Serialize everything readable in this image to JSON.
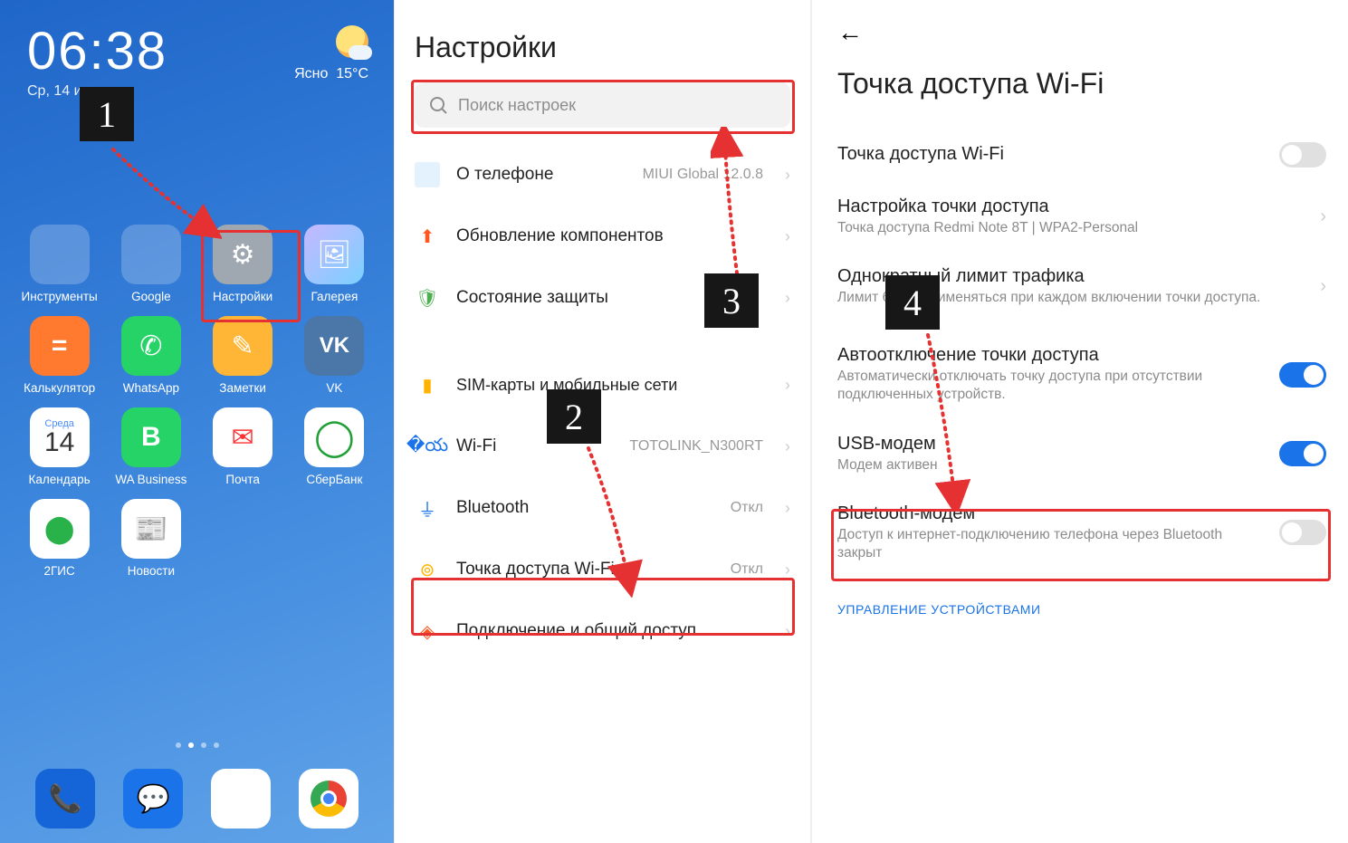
{
  "home": {
    "time": "06:38",
    "date": "Ср, 14 июля",
    "weather_text": "Ясно",
    "weather_temp": "15°C",
    "apps": {
      "tools": "Инструменты",
      "google": "Google",
      "settings": "Настройки",
      "gallery": "Галерея",
      "calc": "Калькулятор",
      "whatsapp": "WhatsApp",
      "notes": "Заметки",
      "vk": "VK",
      "cal_day": "Среда",
      "cal_num": "14",
      "calendar": "Календарь",
      "wab": "WA Business",
      "mail": "Почта",
      "sber": "СберБанк",
      "gis": "2ГИС",
      "news": "Новости"
    }
  },
  "settings": {
    "title": "Настройки",
    "search_placeholder": "Поиск настроек",
    "about": "О телефоне",
    "about_val": "MIUI Global 12.0.8",
    "update": "Обновление компонентов",
    "security": "Состояние защиты",
    "sim": "SIM-карты и мобильные сети",
    "wifi": "Wi-Fi",
    "wifi_val": "TOTOLINK_N300RT",
    "bt": "Bluetooth",
    "bt_val": "Откл",
    "hotspot": "Точка доступа Wi-Fi",
    "hotspot_val": "Откл",
    "share": "Подключение и общий доступ"
  },
  "hotspot": {
    "title": "Точка доступа Wi-Fi",
    "toggle_label": "Точка доступа Wi-Fi",
    "setup": "Настройка точки доступа",
    "setup_sub": "Точка доступа Redmi Note 8T | WPA2-Personal",
    "limit": "Однократный лимит трафика",
    "limit_sub": "Лимит будет применяться при каждом включении точки доступа.",
    "auto": "Автоотключение точки доступа",
    "auto_sub": "Автоматически отключать точку доступа при отсутствии подключенных устройств.",
    "usb": "USB-модем",
    "usb_sub": "Модем активен",
    "btm": "Bluetooth-модем",
    "btm_sub": "Доступ к интернет-подключению телефона через Bluetooth закрыт",
    "section": "УПРАВЛЕНИЕ УСТРОЙСТВАМИ"
  },
  "steps": {
    "s1": "1",
    "s2": "2",
    "s3": "3",
    "s4": "4"
  }
}
